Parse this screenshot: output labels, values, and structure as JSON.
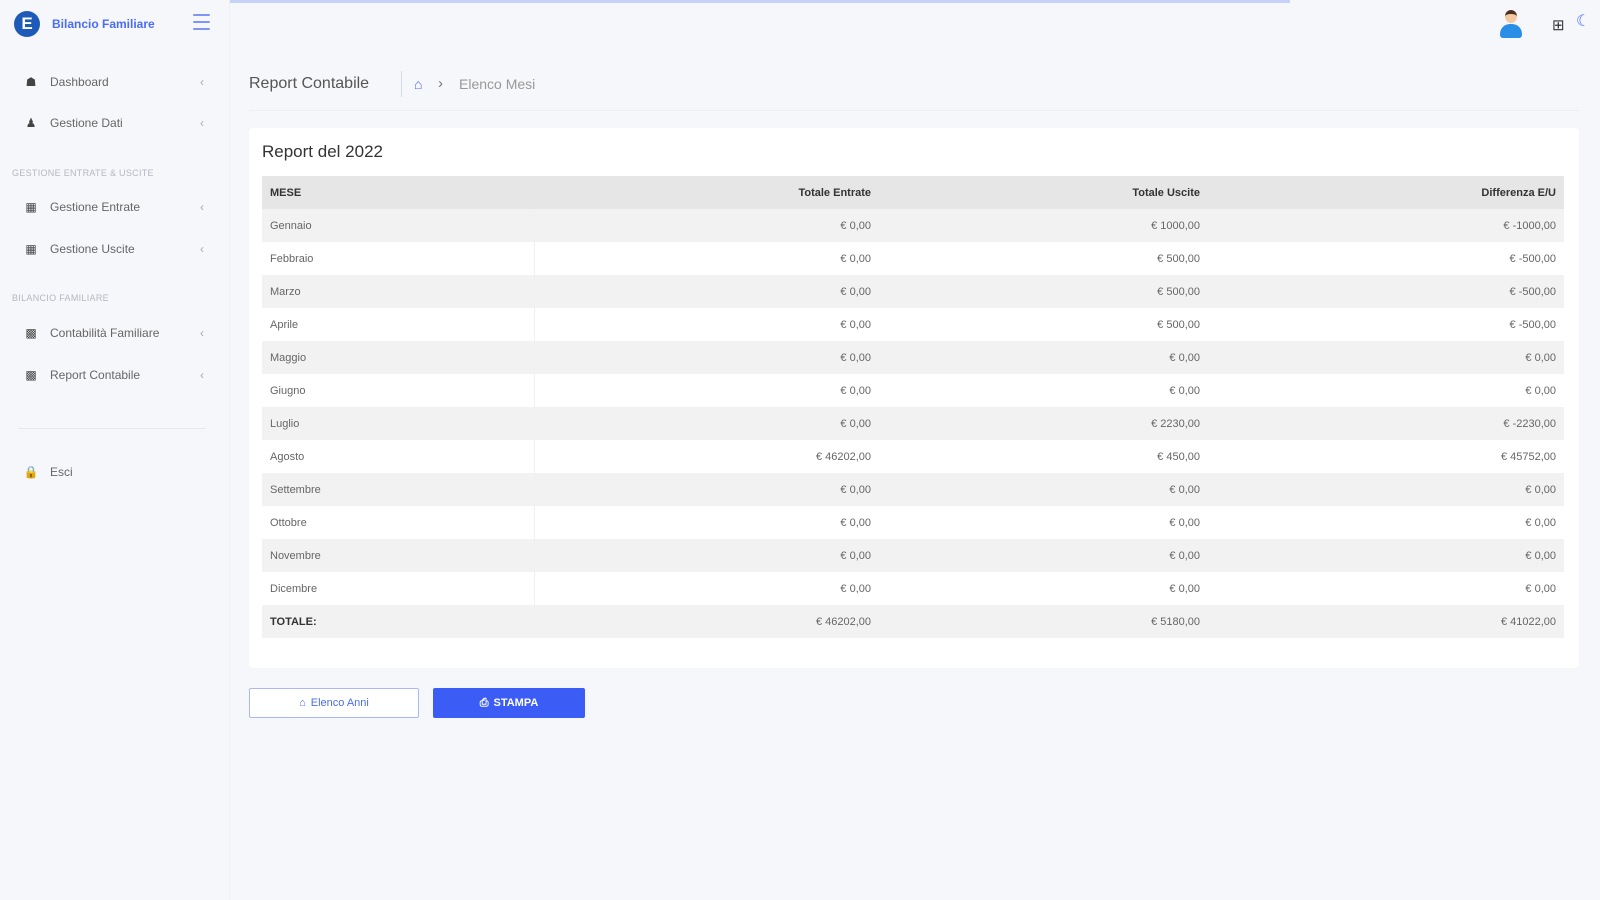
{
  "brand": {
    "logo_letter": "E",
    "name": "Bilancio Familiare"
  },
  "sidebar": {
    "items": [
      {
        "label": "Dashboard",
        "icon": "home-icon"
      },
      {
        "label": "Gestione Dati",
        "icon": "user-icon"
      }
    ],
    "section1": "GESTIONE ENTRATE & USCITE",
    "items2": [
      {
        "label": "Gestione Entrate",
        "icon": "table-icon"
      },
      {
        "label": "Gestione Uscite",
        "icon": "table-icon"
      }
    ],
    "section2": "BILANCIO FAMILIARE",
    "items3": [
      {
        "label": "Contabilità Familiare",
        "icon": "bar-chart-icon"
      },
      {
        "label": "Report Contabile",
        "icon": "bar-chart-icon"
      }
    ],
    "logout": {
      "label": "Esci",
      "icon": "lock-icon"
    }
  },
  "header": {
    "page_title": "Report Contabile",
    "breadcrumb_current": "Elenco Mesi"
  },
  "report": {
    "title": "Report del 2022",
    "columns": [
      "MESE",
      "Totale Entrate",
      "Totale Uscite",
      "Differenza E/U"
    ],
    "rows": [
      [
        "Gennaio",
        "€ 0,00",
        "€ 1000,00",
        "€ -1000,00"
      ],
      [
        "Febbraio",
        "€ 0,00",
        "€ 500,00",
        "€ -500,00"
      ],
      [
        "Marzo",
        "€ 0,00",
        "€ 500,00",
        "€ -500,00"
      ],
      [
        "Aprile",
        "€ 0,00",
        "€ 500,00",
        "€ -500,00"
      ],
      [
        "Maggio",
        "€ 0,00",
        "€ 0,00",
        "€ 0,00"
      ],
      [
        "Giugno",
        "€ 0,00",
        "€ 0,00",
        "€ 0,00"
      ],
      [
        "Luglio",
        "€ 0,00",
        "€ 2230,00",
        "€ -2230,00"
      ],
      [
        "Agosto",
        "€ 46202,00",
        "€ 450,00",
        "€ 45752,00"
      ],
      [
        "Settembre",
        "€ 0,00",
        "€ 0,00",
        "€ 0,00"
      ],
      [
        "Ottobre",
        "€ 0,00",
        "€ 0,00",
        "€ 0,00"
      ],
      [
        "Novembre",
        "€ 0,00",
        "€ 0,00",
        "€ 0,00"
      ],
      [
        "Dicembre",
        "€ 0,00",
        "€ 0,00",
        "€ 0,00"
      ]
    ],
    "total": [
      "TOTALE:",
      "€ 46202,00",
      "€ 5180,00",
      "€ 41022,00"
    ]
  },
  "buttons": {
    "back_label": "Elenco Anni",
    "print_label": "STAMPA"
  },
  "colors": {
    "accent": "#4a6cf7",
    "primary_button": "#3b5cf5"
  }
}
